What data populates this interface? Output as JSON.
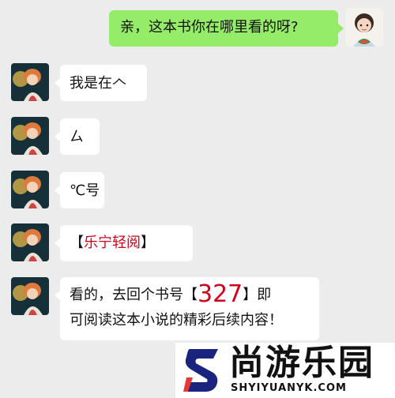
{
  "messages": [
    {
      "side": "right",
      "text": "亲，这本书你在哪里看的呀?"
    },
    {
      "side": "left",
      "text": "我是在𠆢"
    },
    {
      "side": "left",
      "text": "ㄙ"
    },
    {
      "side": "left",
      "text": "℃号"
    },
    {
      "side": "left",
      "text_open": "【",
      "text_highlight": "乐宁轻阅",
      "text_close": "】"
    },
    {
      "side": "left",
      "line1_prefix": "看的，去回个书号【",
      "line1_number": "327",
      "line1_suffix": "】即",
      "line2": "可阅读这本小说的精彩后续内容！"
    }
  ],
  "banner": {
    "brand": "尚游乐园",
    "domain": "SHYIYUANYK.COM"
  },
  "colors": {
    "background": "#ececec",
    "sent_bubble": "#95ec69",
    "received_bubble": "#ffffff",
    "highlight": "#d0021b"
  }
}
